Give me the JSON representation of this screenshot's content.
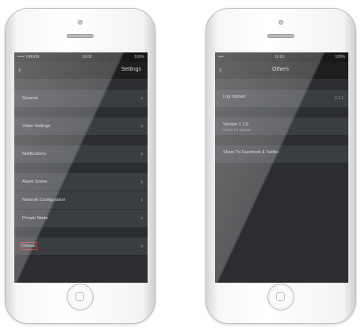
{
  "left_screen": {
    "status": {
      "carrier": "••••• VIRGIN",
      "time": "16:00",
      "battery": "100%"
    },
    "title": "Settings",
    "group1": [
      "General"
    ],
    "group2": [
      "Video Settings"
    ],
    "group3": [
      "Notifications"
    ],
    "group4": [
      "Alarm Scene",
      "Network Configuration",
      "Private Mode"
    ],
    "group5": [
      "Others"
    ]
  },
  "right_screen": {
    "status": {
      "carrier": "••••",
      "time": "16:01",
      "battery": "100%"
    },
    "title": "Others",
    "items": [
      {
        "label": "Log Upload",
        "detail": "",
        "trailing": "1.1.1"
      },
      {
        "label": "Version 1.1.0",
        "detail": "Check for update",
        "trailing": ""
      },
      {
        "label": "Share To Facebook & Twitter",
        "detail": "",
        "trailing": ""
      }
    ]
  }
}
